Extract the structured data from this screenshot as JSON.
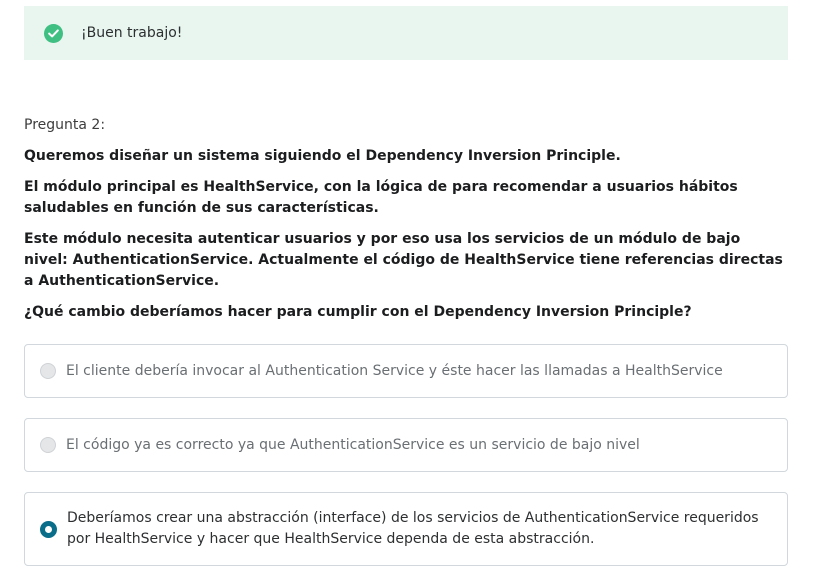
{
  "feedback": {
    "message": "¡Buen trabajo!",
    "icon": "check-circle-icon",
    "color": "#3fbf82",
    "background": "#e8f6ef"
  },
  "question": {
    "number_label": "Pregunta 2:",
    "paragraphs": [
      "Queremos diseñar un sistema siguiendo el Dependency Inversion Principle.",
      "El módulo principal es HealthService, con la lógica de para recomendar a usuarios hábitos saludables en función de sus características.",
      "Este módulo necesita autenticar usuarios y por eso usa los servicios de un módulo de bajo nivel: AuthenticationService. Actualmente el código de HealthService tiene referencias directas a AuthenticationService.",
      "¿Qué cambio deberíamos hacer para cumplir con el Dependency Inversion Principle?"
    ]
  },
  "options": [
    {
      "label": "El cliente debería invocar al Authentication Service y éste hacer las llamadas a HealthService",
      "selected": false
    },
    {
      "label": "El código ya es correcto ya que AuthenticationService es un servicio de bajo nivel",
      "selected": false
    },
    {
      "label": "Deberíamos crear una abstracción (interface) de los servicios de AuthenticationService requeridos por HealthService y hacer que HealthService dependa de esta abstracción.",
      "selected": true
    }
  ],
  "colors": {
    "selected_radio": "#0a6e8a",
    "border": "#d1d7dc"
  }
}
